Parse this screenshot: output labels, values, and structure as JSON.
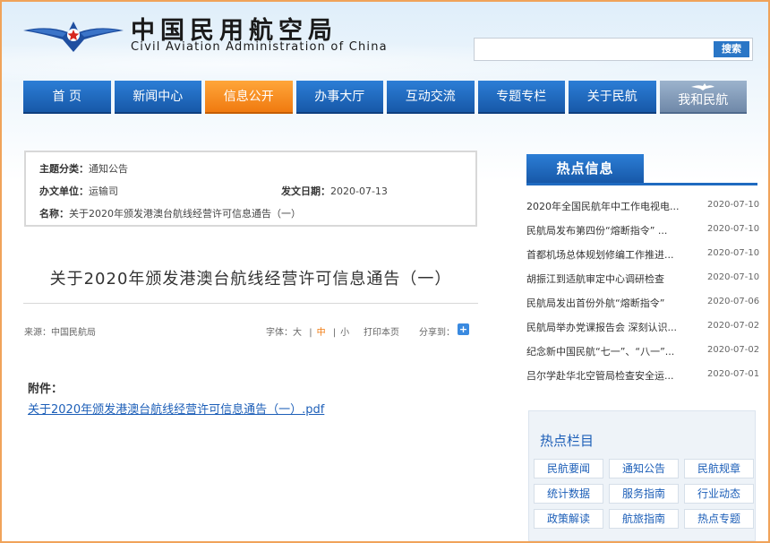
{
  "header": {
    "title_cn": "中国民用航空局",
    "title_en": "Civil Aviation Administration of China",
    "search_placeholder": "",
    "search_button": "搜索"
  },
  "nav": {
    "items": [
      {
        "label": "首 页"
      },
      {
        "label": "新闻中心"
      },
      {
        "label": "信息公开"
      },
      {
        "label": "办事大厅"
      },
      {
        "label": "互动交流"
      },
      {
        "label": "专题专栏"
      },
      {
        "label": "关于民航"
      },
      {
        "label": "我和民航"
      }
    ],
    "active_label": "信息公开"
  },
  "meta": {
    "category_label": "主题分类：",
    "category_value": "通知公告",
    "office_label": "办文单位：",
    "office_value": "运输司",
    "date_label": "发文日期：",
    "date_value": "2020-07-13",
    "name_label": "名称：",
    "name_value": "关于2020年颁发港澳台航线经营许可信息通告（一）"
  },
  "article": {
    "title": "关于2020年颁发港澳台航线经营许可信息通告（一）",
    "source": "来源：中国民航局",
    "font_label": "字体：",
    "font_large": "大",
    "font_medium": "中",
    "font_small": "小",
    "sep": "|",
    "print": "打印本页",
    "share": "分享到：",
    "share_icon": "+",
    "attach_label": "附件：",
    "attach_link": "关于2020年颁发港澳台航线经营许可信息通告（一）.pdf"
  },
  "hot": {
    "title": "热点信息",
    "items": [
      {
        "title": "2020年全国民航年中工作电视电...",
        "date": "2020-07-10"
      },
      {
        "title": "民航局发布第四份“熔断指令” ...",
        "date": "2020-07-10"
      },
      {
        "title": "首都机场总体规划修编工作推进...",
        "date": "2020-07-10"
      },
      {
        "title": "胡振江到适航审定中心调研检查",
        "date": "2020-07-10"
      },
      {
        "title": "民航局发出首份外航“熔断指令”",
        "date": "2020-07-06"
      },
      {
        "title": "民航局举办党课报告会 深刻认识...",
        "date": "2020-07-02"
      },
      {
        "title": "纪念新中国民航“七一”、“八一”...",
        "date": "2020-07-02"
      },
      {
        "title": "吕尔学赴华北空管局检查安全运...",
        "date": "2020-07-01"
      }
    ]
  },
  "columns": {
    "title": "热点栏目",
    "items": [
      {
        "label": "民航要闻"
      },
      {
        "label": "通知公告"
      },
      {
        "label": "民航规章"
      },
      {
        "label": "统计数据"
      },
      {
        "label": "服务指南"
      },
      {
        "label": "行业动态"
      },
      {
        "label": "政策解读"
      },
      {
        "label": "航旅指南"
      },
      {
        "label": "热点专题"
      }
    ]
  }
}
